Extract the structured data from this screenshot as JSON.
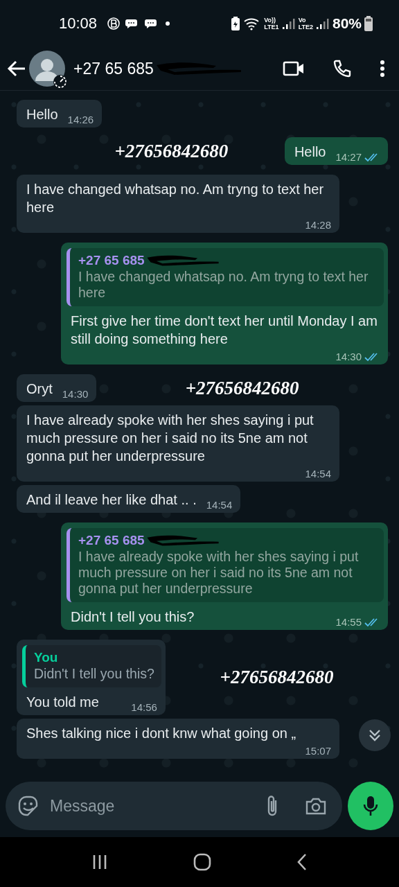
{
  "status_bar": {
    "time": "10:08",
    "sim1": {
      "volte": "Vo))",
      "network": "LTE1"
    },
    "sim2": {
      "volte": "Vo",
      "network": "LTE2"
    },
    "battery": "80%"
  },
  "header": {
    "contact": "+27 65 685",
    "redacted": true
  },
  "messages": [
    {
      "outgoing": false,
      "text": "Hello",
      "time": "14:26"
    },
    {
      "outgoing": true,
      "text": "Hello",
      "time": "14:27",
      "read": true,
      "annotation": "+27656842680"
    },
    {
      "outgoing": false,
      "text": "I have changed whatsap no. Am tryng to text her  here",
      "time": "14:28"
    },
    {
      "outgoing": true,
      "quote": {
        "author": "+27 65 685",
        "redacted": true,
        "color": "#a791f0",
        "text": "I have changed whatsap no. Am tryng to text her here"
      },
      "text": "First give her time don't text her until Monday I am still doing something here",
      "time": "14:30",
      "read": true
    },
    {
      "outgoing": false,
      "text": "Oryt",
      "time": "14:30",
      "annotation": "+27656842680"
    },
    {
      "outgoing": false,
      "text": "I have already spoke with her shes saying i put much pressure on her i said no its 5ne am not gonna put her underpressure",
      "time": "14:54"
    },
    {
      "outgoing": false,
      "text": "And il leave her like dhat .. .",
      "time": "14:54"
    },
    {
      "outgoing": true,
      "quote": {
        "author": "+27 65 685",
        "redacted": true,
        "color": "#a791f0",
        "text": "I have already spoke with her shes saying i put much pressure on her i said no its 5ne am not gonna put her underpressure"
      },
      "text": "Didn't I tell you this?",
      "time": "14:55",
      "read": true
    },
    {
      "outgoing": false,
      "quote": {
        "author": "You",
        "redacted": false,
        "color": "#06cf9c",
        "text": "Didn't I tell you this?"
      },
      "text": "You told me",
      "time": "14:56",
      "annotation": "+27656842680"
    },
    {
      "outgoing": false,
      "text": "Shes talking nice i dont knw what going on „",
      "time": "15:07"
    }
  ],
  "composer": {
    "placeholder": "Message"
  }
}
